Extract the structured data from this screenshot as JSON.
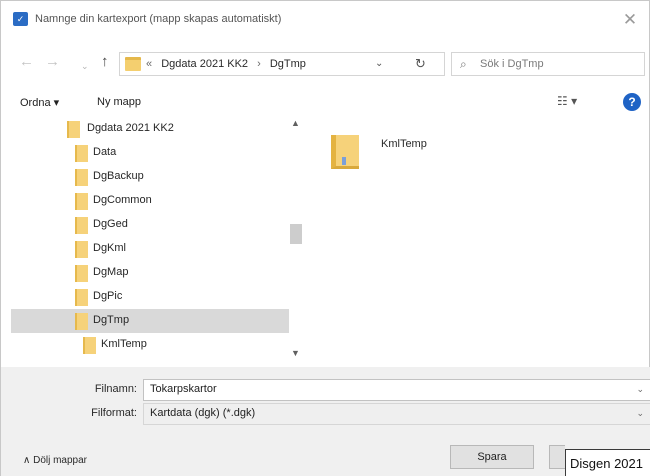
{
  "window": {
    "title": "Namnge din kartexport (mapp skapas automatiskt)",
    "close_glyph": "✕",
    "app_icon": "app-icon"
  },
  "nav": {
    "back_glyph": "←",
    "forward_glyph": "→",
    "history_glyph": "⌄",
    "up_glyph": "↑",
    "breadcrumbs": [
      "«",
      "Dgdata 2021 KK2",
      "›",
      "DgTmp"
    ],
    "dropdown_glyph": "⌄",
    "refresh_glyph": "↻",
    "search_placeholder": "Sök i DgTmp"
  },
  "toolbar": {
    "organize_label": "Ordna ▾",
    "new_folder_label": "Ny mapp",
    "view_glyph": "☷ ▾",
    "help_glyph": "?"
  },
  "tree": {
    "items": [
      {
        "label": "Dgdata 2021 KK2",
        "level": 0,
        "selected": false
      },
      {
        "label": "Data",
        "level": 1,
        "selected": false
      },
      {
        "label": "DgBackup",
        "level": 1,
        "selected": false
      },
      {
        "label": "DgCommon",
        "level": 1,
        "selected": false
      },
      {
        "label": "DgGed",
        "level": 1,
        "selected": false
      },
      {
        "label": "DgKml",
        "level": 1,
        "selected": false
      },
      {
        "label": "DgMap",
        "level": 1,
        "selected": false
      },
      {
        "label": "DgPic",
        "level": 1,
        "selected": false
      },
      {
        "label": "DgTmp",
        "level": 1,
        "selected": true
      },
      {
        "label": "KmlTemp",
        "level": 2,
        "selected": false
      }
    ],
    "scroll_up_glyph": "▲",
    "scroll_down_glyph": "▼"
  },
  "files": {
    "items": [
      {
        "name": "KmlTemp",
        "icon": "folder-icon"
      }
    ]
  },
  "form": {
    "filename_label": "Filnamn:",
    "filename_value": "Tokarpskartor",
    "filetype_label": "Filformat:",
    "filetype_value": "Kartdata (dgk) (*.dgk)",
    "dropdown_glyph": "⌄"
  },
  "footer": {
    "hide_folders_label": "∧  Dölj mappar",
    "save_label": "Spara"
  },
  "tooltip": {
    "text": "Disgen 2021"
  }
}
